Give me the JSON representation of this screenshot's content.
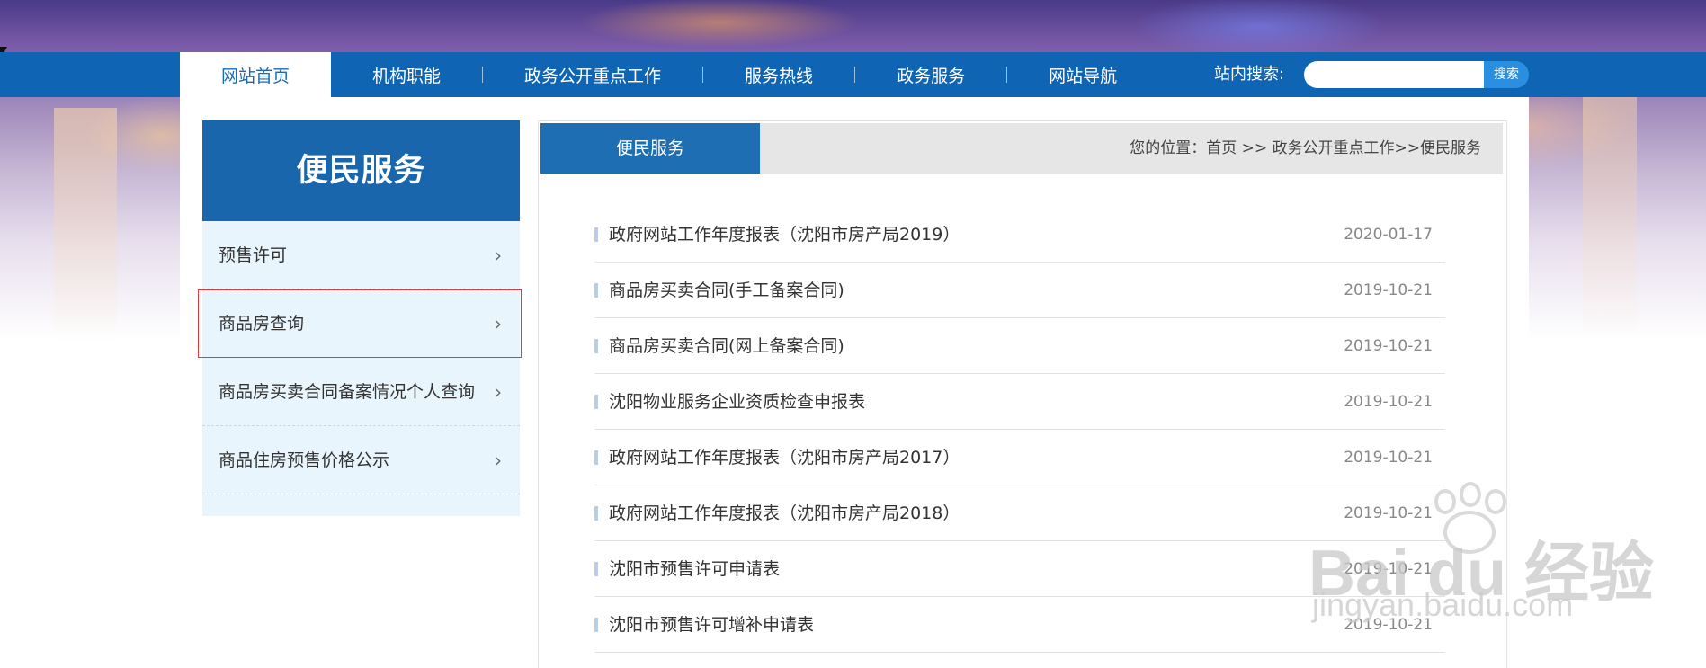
{
  "nav": {
    "items": [
      "网站首页",
      "机构职能",
      "政务公开重点工作",
      "服务热线",
      "政务服务",
      "网站导航"
    ],
    "active_index": 0,
    "search_label": "站内搜索:",
    "search_placeholder": "",
    "search_button": "搜索"
  },
  "sidebar": {
    "title": "便民服务",
    "items": [
      {
        "label": "预售许可"
      },
      {
        "label": "商品房查询"
      },
      {
        "label": "商品房买卖合同备案情况个人查询"
      },
      {
        "label": "商品住房预售价格公示"
      }
    ],
    "selected_index": 1
  },
  "content": {
    "tab": "便民服务",
    "breadcrumb": "您的位置：首页 >> 政务公开重点工作>>便民服务",
    "rows": [
      {
        "title": "政府网站工作年度报表（沈阳市房产局2019）",
        "date": "2020-01-17"
      },
      {
        "title": "商品房买卖合同(手工备案合同)",
        "date": "2019-10-21"
      },
      {
        "title": "商品房买卖合同(网上备案合同)",
        "date": "2019-10-21"
      },
      {
        "title": "沈阳物业服务企业资质检查申报表",
        "date": "2019-10-21"
      },
      {
        "title": "政府网站工作年度报表（沈阳市房产局2017）",
        "date": "2019-10-21"
      },
      {
        "title": "政府网站工作年度报表（沈阳市房产局2018）",
        "date": "2019-10-21"
      },
      {
        "title": "沈阳市预售许可申请表",
        "date": "2019-10-21"
      },
      {
        "title": "沈阳市预售许可增补申请表",
        "date": "2019-10-21"
      }
    ]
  },
  "watermark": {
    "brand": "Bai du 经验",
    "url": "jingyan.baidu.com"
  },
  "colors": {
    "nav_bg": "#0f64b3",
    "sidebar_head": "#1a66ad",
    "accent": "#1e6eb4",
    "highlight": "#e23a3a"
  }
}
